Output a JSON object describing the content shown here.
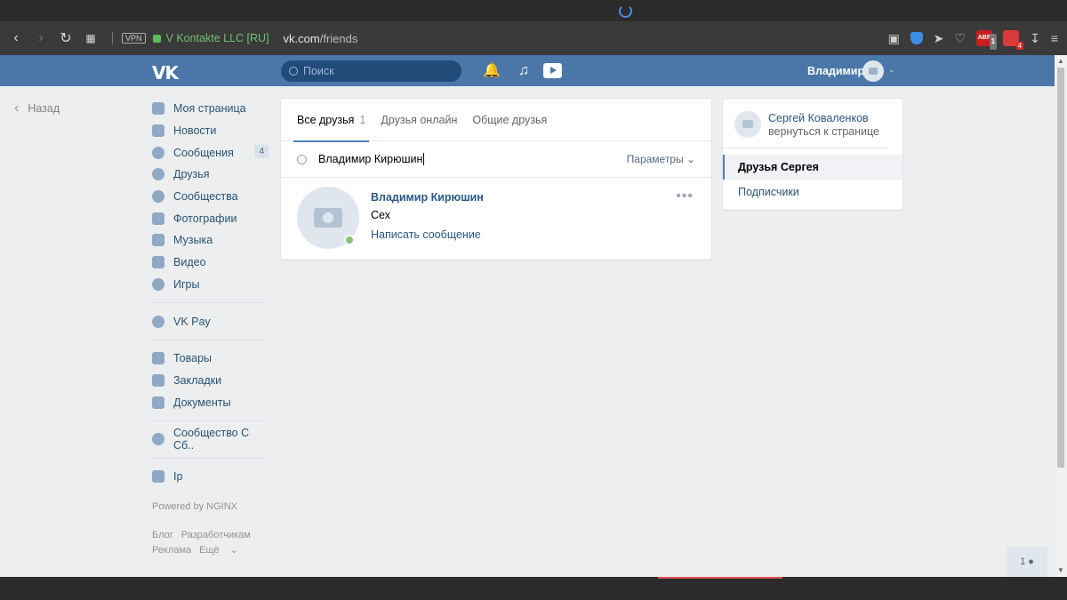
{
  "browser": {
    "vpn_label": "VPN",
    "cert_label": "V Kontakte LLC [RU]",
    "url_host": "vk.com",
    "url_path": "/friends",
    "ext_abp_label": "ABP",
    "ext_abp_badge": "1",
    "ext_red_badge": "4"
  },
  "header": {
    "logo": "VK",
    "search_placeholder": "Поиск",
    "user_name": "Владимир"
  },
  "back_label": "Назад",
  "sidebar": {
    "items": [
      {
        "label": "Моя страница"
      },
      {
        "label": "Новости"
      },
      {
        "label": "Сообщения",
        "count": "4"
      },
      {
        "label": "Друзья"
      },
      {
        "label": "Сообщества"
      },
      {
        "label": "Фотографии"
      },
      {
        "label": "Музыка"
      },
      {
        "label": "Видео"
      },
      {
        "label": "Игры"
      }
    ],
    "pay": "VK Pay",
    "group2": [
      {
        "label": "Товары"
      },
      {
        "label": "Закладки"
      },
      {
        "label": "Документы"
      }
    ],
    "community": "Сообщество С Сб..",
    "ip": "Ip",
    "powered": "Powered by NGINX",
    "footer_links": [
      "Блог",
      "Разработчикам",
      "Реклама",
      "Ещё"
    ]
  },
  "main": {
    "tabs": [
      {
        "label": "Все друзья",
        "count": "1"
      },
      {
        "label": "Друзья онлайн"
      },
      {
        "label": "Общие друзья"
      }
    ],
    "search_value": "Владимир Кирюшин",
    "params_label": "Параметры",
    "friend": {
      "name": "Владимир Кирюшин",
      "city": "Сех",
      "message_link": "Написать сообщение"
    }
  },
  "right_panel": {
    "name": "Сергей Коваленков",
    "back_text": "вернуться к странице",
    "items": [
      "Друзья Сергея",
      "Подписчики"
    ]
  },
  "float_chat": "1"
}
